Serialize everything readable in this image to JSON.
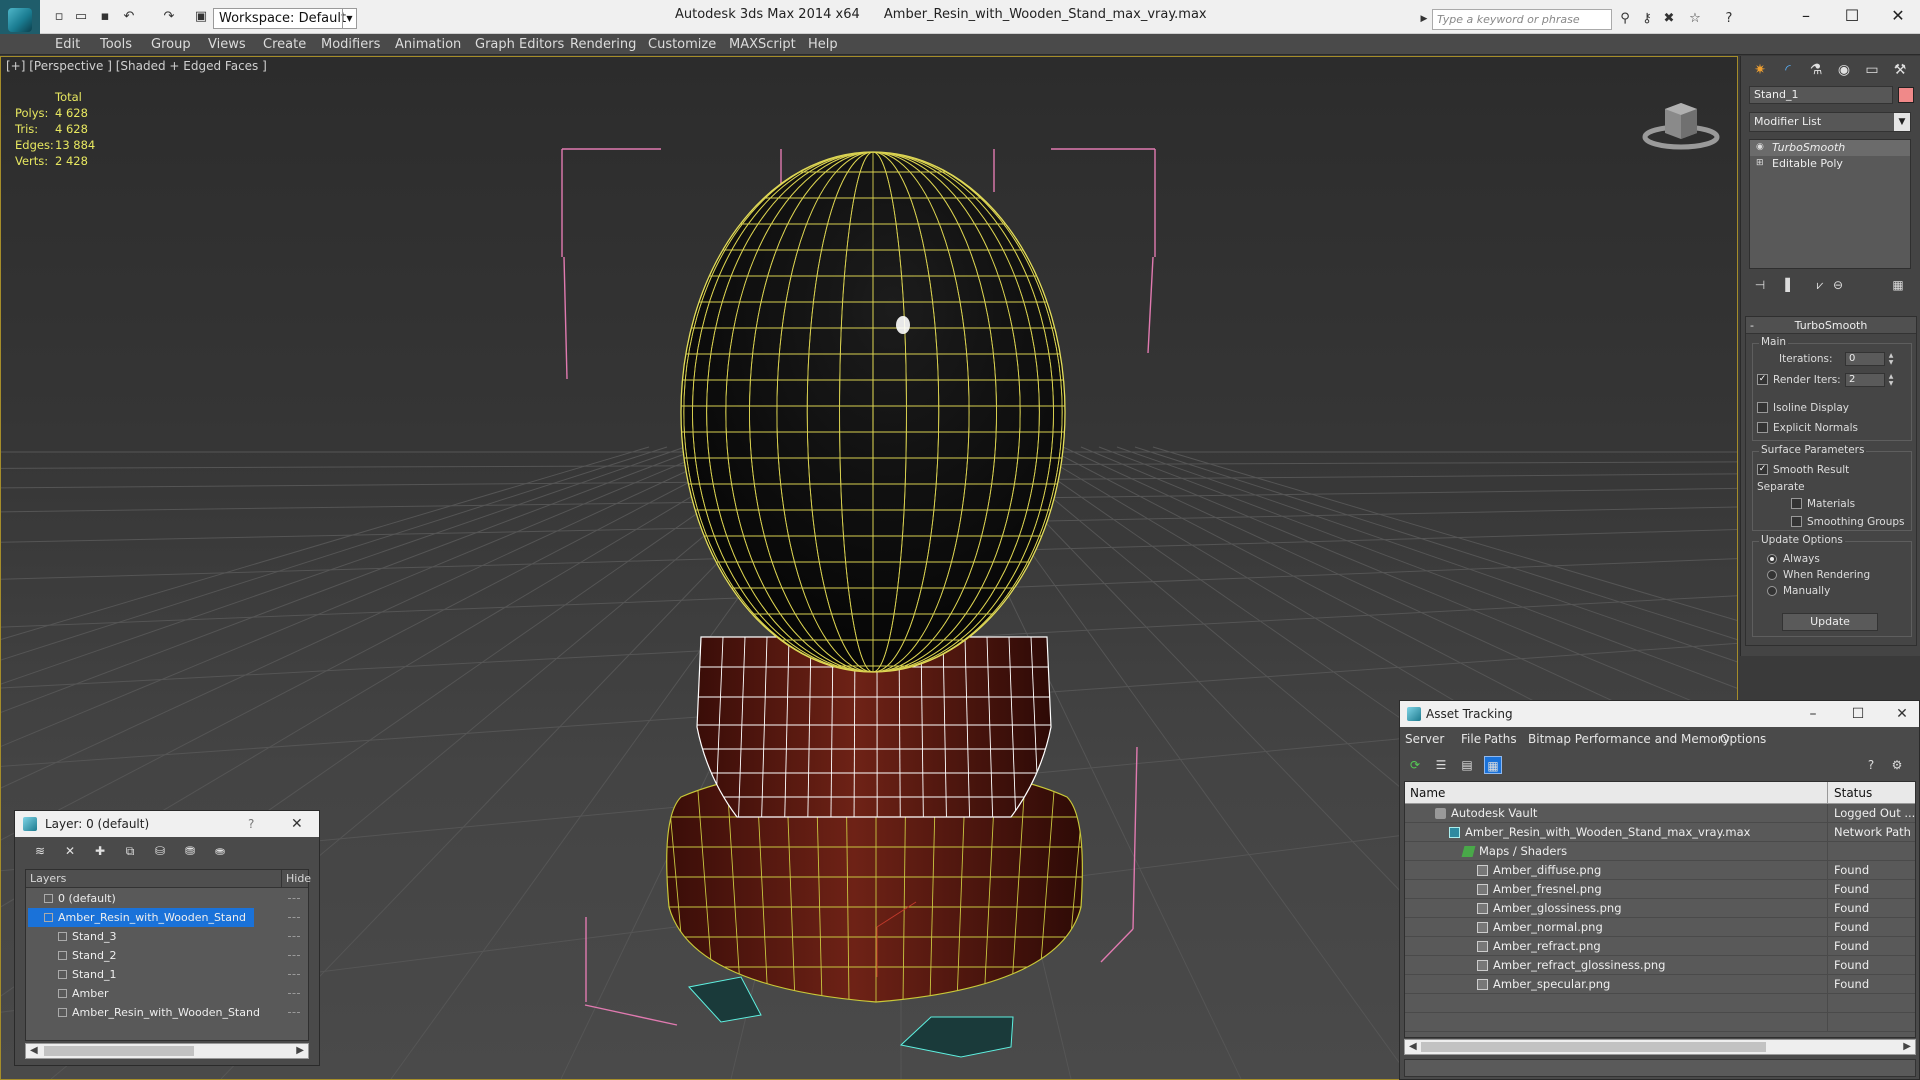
{
  "titlebar": {
    "workspace": "Workspace: Default",
    "app_name": "Autodesk 3ds Max  2014 x64",
    "file_name": "Amber_Resin_with_Wooden_Stand_max_vray.max",
    "search_placeholder": "Type a keyword or phrase",
    "minimize": "–",
    "maximize": "☐",
    "close": "✕"
  },
  "menu": [
    "Edit",
    "Tools",
    "Group",
    "Views",
    "Create",
    "Modifiers",
    "Animation",
    "Graph Editors",
    "Rendering",
    "Customize",
    "MAXScript",
    "Help"
  ],
  "viewport": {
    "label": "[+] [Perspective ] [Shaded + Edged Faces ]",
    "stats": {
      "header": "Total",
      "rows": [
        {
          "label": "Polys:",
          "value": "4 628"
        },
        {
          "label": "Tris:",
          "value": "4 628"
        },
        {
          "label": "Edges:",
          "value": "13 884"
        },
        {
          "label": "Verts:",
          "value": "2 428"
        }
      ]
    },
    "colors": {
      "selection": "#f088c8",
      "wire_egg": "#e4de5a",
      "wire_base": "#ffffff",
      "wire_foot": "#5ef0e0",
      "wood": "#5a1a12"
    }
  },
  "command_panel": {
    "object_name": "Stand_1",
    "object_color": "#f08989",
    "modifier_list": "Modifier List",
    "stack": [
      {
        "label": "TurboSmooth",
        "selected": true
      },
      {
        "label": "Editable Poly",
        "selected": false
      }
    ],
    "rollout": {
      "title": "TurboSmooth",
      "main_group": "Main",
      "iterations_label": "Iterations:",
      "iterations_value": "0",
      "render_iters_label": "Render Iters:",
      "render_iters_value": "2",
      "isoline": "Isoline Display",
      "explicit_normals": "Explicit Normals",
      "surface_group": "Surface Parameters",
      "smooth_result": "Smooth Result",
      "separate": "Separate",
      "materials": "Materials",
      "smoothing_groups": "Smoothing Groups",
      "update_group": "Update Options",
      "always": "Always",
      "when_rendering": "When Rendering",
      "manually": "Manually",
      "update_button": "Update"
    }
  },
  "layer_window": {
    "title": "Layer: 0 (default)",
    "help": "?",
    "close": "✕",
    "col_layers": "Layers",
    "col_hide": "Hide",
    "rows": [
      {
        "name": "0 (default)",
        "indent": 1,
        "selected": false
      },
      {
        "name": "Amber_Resin_with_Wooden_Stand",
        "indent": 1,
        "selected": true
      },
      {
        "name": "Stand_3",
        "indent": 2,
        "selected": false
      },
      {
        "name": "Stand_2",
        "indent": 2,
        "selected": false
      },
      {
        "name": "Stand_1",
        "indent": 2,
        "selected": false
      },
      {
        "name": "Amber",
        "indent": 2,
        "selected": false
      },
      {
        "name": "Amber_Resin_with_Wooden_Stand",
        "indent": 2,
        "selected": false
      }
    ]
  },
  "asset_window": {
    "title": "Asset Tracking",
    "menu": [
      "Server",
      "File",
      "Paths",
      "Bitmap Performance and Memory",
      "Options"
    ],
    "col_name": "Name",
    "col_status": "Status",
    "rows": [
      {
        "name": "Autodesk Vault",
        "status": "Logged Out ...",
        "indent": 1,
        "icon": "vault"
      },
      {
        "name": "Amber_Resin_with_Wooden_Stand_max_vray.max",
        "status": "Network Path",
        "indent": 2,
        "icon": "max"
      },
      {
        "name": "Maps / Shaders",
        "status": "",
        "indent": 3,
        "icon": "shader"
      },
      {
        "name": "Amber_diffuse.png",
        "status": "Found",
        "indent": 4,
        "icon": "file"
      },
      {
        "name": "Amber_fresnel.png",
        "status": "Found",
        "indent": 4,
        "icon": "file"
      },
      {
        "name": "Amber_glossiness.png",
        "status": "Found",
        "indent": 4,
        "icon": "file"
      },
      {
        "name": "Amber_normal.png",
        "status": "Found",
        "indent": 4,
        "icon": "file"
      },
      {
        "name": "Amber_refract.png",
        "status": "Found",
        "indent": 4,
        "icon": "file"
      },
      {
        "name": "Amber_refract_glossiness.png",
        "status": "Found",
        "indent": 4,
        "icon": "file"
      },
      {
        "name": "Amber_specular.png",
        "status": "Found",
        "indent": 4,
        "icon": "file"
      }
    ]
  }
}
